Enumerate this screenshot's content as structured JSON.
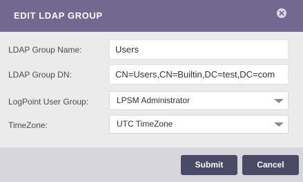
{
  "dialog": {
    "title": "EDIT LDAP GROUP",
    "close_icon": "close-circle-icon"
  },
  "form": {
    "group_name": {
      "label": "LDAP Group Name:",
      "value": "Users"
    },
    "group_dn": {
      "label": "LDAP Group DN:",
      "value": "CN=Users,CN=Builtin,DC=test,DC=com"
    },
    "user_group": {
      "label": "LogPoint User Group:",
      "value": "LPSM Administrator"
    },
    "timezone": {
      "label": "TimeZone:",
      "value": "UTC TimeZone"
    }
  },
  "footer": {
    "submit_label": "Submit",
    "cancel_label": "Cancel"
  },
  "colors": {
    "header_bg": "#726890",
    "button_bg": "#4a4a66",
    "body_bg": "#ebebeb",
    "footer_bg": "#d8d6dd"
  }
}
